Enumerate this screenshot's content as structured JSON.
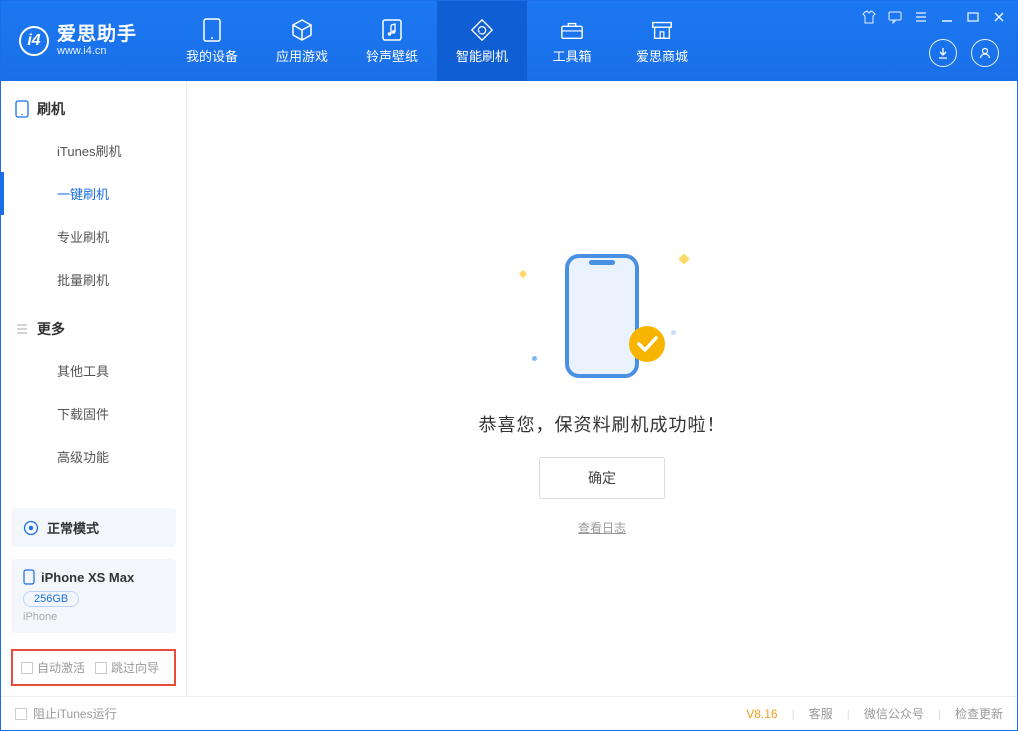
{
  "header": {
    "logo_title": "爱思助手",
    "logo_sub": "www.i4.cn",
    "tabs": [
      {
        "label": "我的设备",
        "icon": "device-icon"
      },
      {
        "label": "应用游戏",
        "icon": "cube-icon"
      },
      {
        "label": "铃声壁纸",
        "icon": "music-icon"
      },
      {
        "label": "智能刷机",
        "icon": "refresh-icon"
      },
      {
        "label": "工具箱",
        "icon": "toolbox-icon"
      },
      {
        "label": "爱思商城",
        "icon": "store-icon"
      }
    ],
    "active_tab": 3
  },
  "sidebar": {
    "section1_title": "刷机",
    "section1_items": [
      "iTunes刷机",
      "一键刷机",
      "专业刷机",
      "批量刷机"
    ],
    "section1_active": 1,
    "section2_title": "更多",
    "section2_items": [
      "其他工具",
      "下载固件",
      "高级功能"
    ],
    "status_label": "正常模式",
    "device_name": "iPhone XS Max",
    "device_capacity": "256GB",
    "device_type": "iPhone",
    "check1_label": "自动激活",
    "check2_label": "跳过向导"
  },
  "main": {
    "success_msg": "恭喜您，保资料刷机成功啦！",
    "ok_button": "确定",
    "log_link": "查看日志"
  },
  "footer": {
    "stop_itunes": "阻止iTunes运行",
    "version": "V8.16",
    "links": [
      "客服",
      "微信公众号",
      "检查更新"
    ]
  }
}
